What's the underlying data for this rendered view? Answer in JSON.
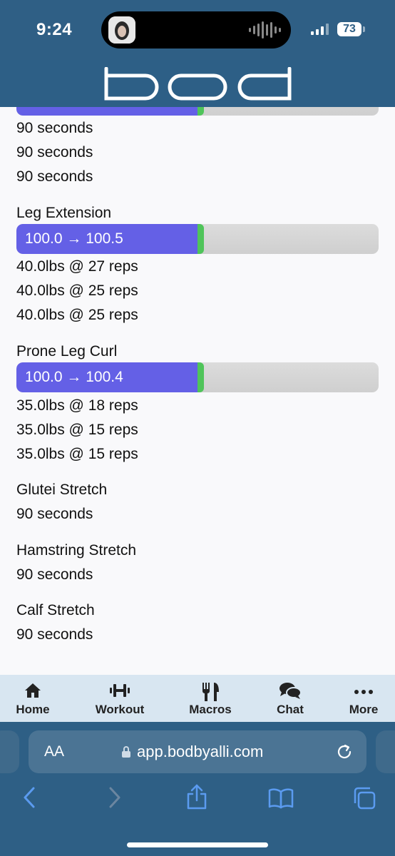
{
  "status": {
    "time": "9:24",
    "battery": "73"
  },
  "header": {
    "logo_text": "bod"
  },
  "exercises": [
    {
      "title": "",
      "progress": {
        "label": "",
        "fill_pct": 50
      },
      "lines": [
        "90 seconds",
        "90 seconds",
        "90 seconds"
      ]
    },
    {
      "title": "Leg Extension",
      "progress": {
        "label": "100.0 → 100.5",
        "fill_pct": 50
      },
      "lines": [
        "40.0lbs @ 27 reps",
        "40.0lbs @ 25 reps",
        "40.0lbs @ 25 reps"
      ]
    },
    {
      "title": "Prone Leg Curl",
      "progress": {
        "label": "100.0 → 100.4",
        "fill_pct": 50
      },
      "lines": [
        "35.0lbs @ 18 reps",
        "35.0lbs @ 15 reps",
        "35.0lbs @ 15 reps"
      ]
    },
    {
      "title": "Glutei Stretch",
      "lines": [
        "90 seconds"
      ]
    },
    {
      "title": "Hamstring Stretch",
      "lines": [
        "90 seconds"
      ]
    },
    {
      "title": "Calf Stretch",
      "lines": [
        "90 seconds"
      ]
    }
  ],
  "tabbar": {
    "items": [
      {
        "label": "Home",
        "icon": "home-icon"
      },
      {
        "label": "Workout",
        "icon": "dumbbell-icon"
      },
      {
        "label": "Macros",
        "icon": "utensils-icon"
      },
      {
        "label": "Chat",
        "icon": "chat-icon"
      },
      {
        "label": "More",
        "icon": "more-icon"
      }
    ]
  },
  "browser": {
    "text_size_label": "AA",
    "url": "app.bodbyalli.com"
  },
  "colors": {
    "header": "#2d5f86",
    "progress_fill": "#6460e6",
    "progress_edge": "#4fc45a",
    "tabbar": "#d8e6f1",
    "browser_accent": "#5b9bf0"
  }
}
